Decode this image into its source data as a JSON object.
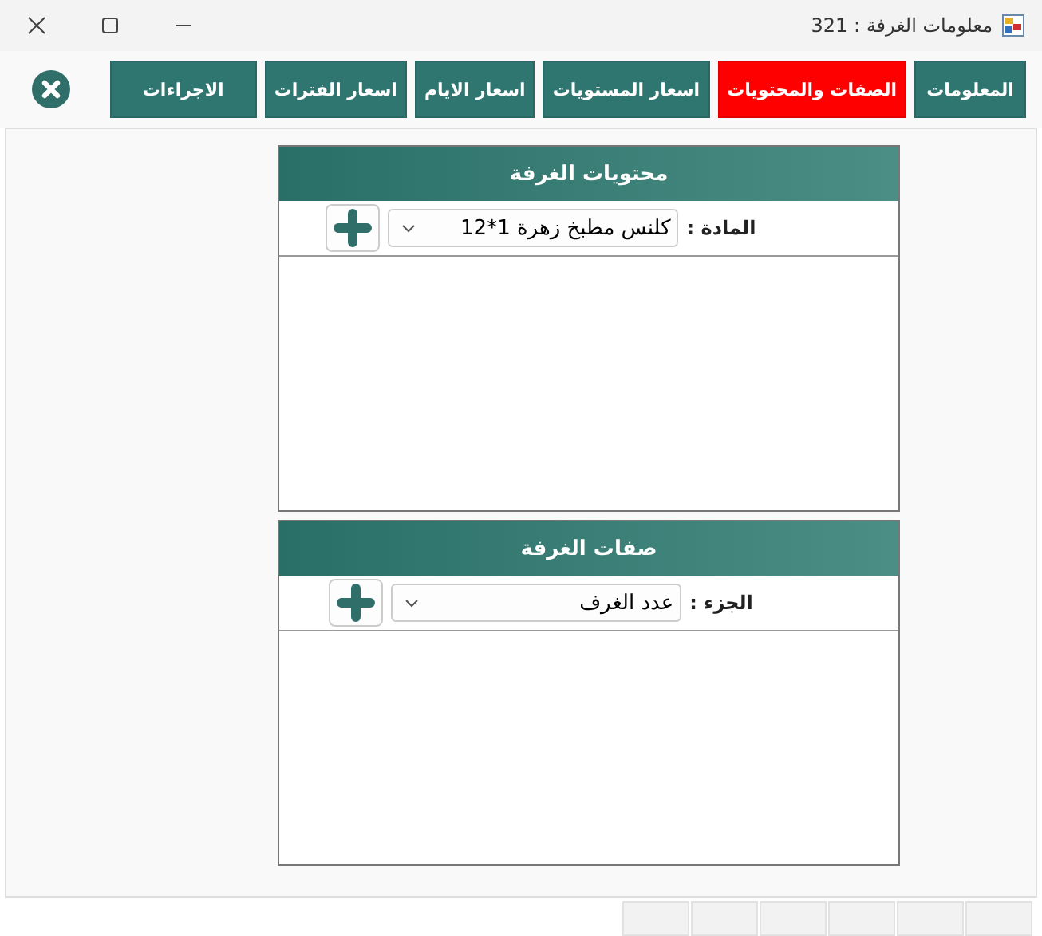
{
  "window": {
    "title": "معلومات الغرفة : 321"
  },
  "tabs": [
    {
      "label": "المعلومات",
      "selected": false
    },
    {
      "label": "الصفات والمحتويات",
      "selected": true
    },
    {
      "label": "اسعار المستويات",
      "selected": false
    },
    {
      "label": "اسعار الايام",
      "selected": false
    },
    {
      "label": "اسعار الفترات",
      "selected": false
    },
    {
      "label": "الاجراءات",
      "selected": false
    }
  ],
  "panels": [
    {
      "title": "محتويات الغرفة",
      "label": "المادة :",
      "value": "كلنس مطبخ زهرة 1*12"
    },
    {
      "title": "صفات الغرفة",
      "label": "الجزء :",
      "value": "عدد الغرف"
    }
  ]
}
